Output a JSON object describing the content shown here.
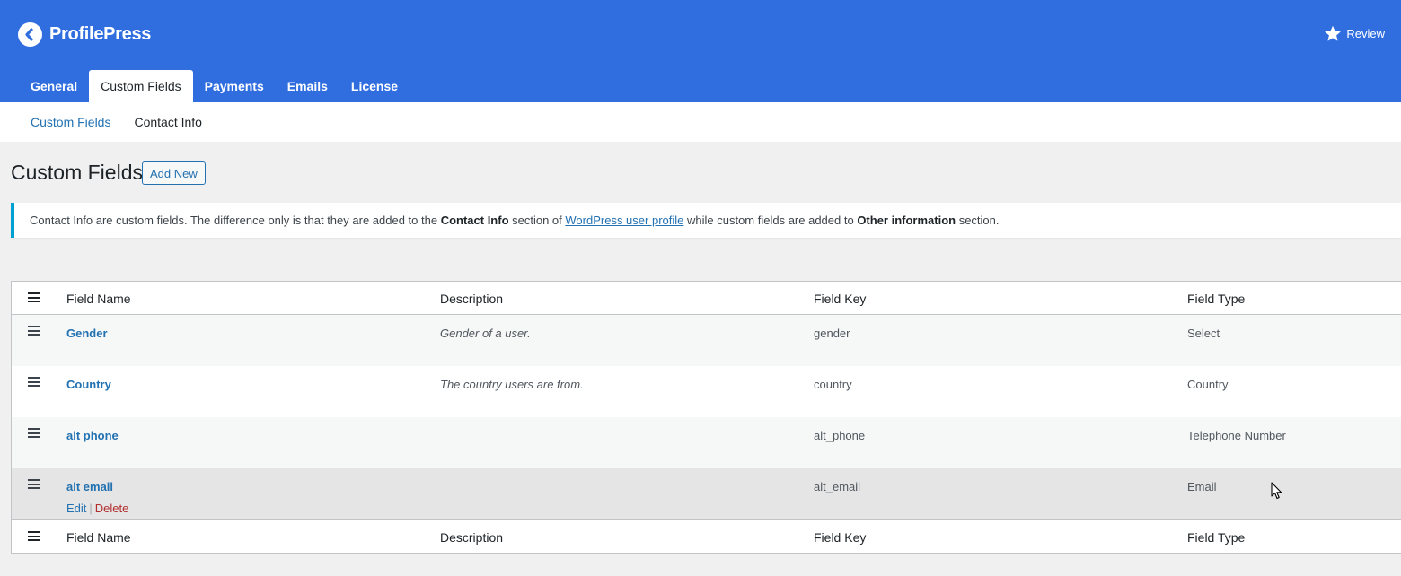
{
  "brand": {
    "name_bold": "Profile",
    "name_rest": "Press"
  },
  "header": {
    "review_label": "Review"
  },
  "tabs": [
    {
      "label": "General"
    },
    {
      "label": "Custom Fields"
    },
    {
      "label": "Payments"
    },
    {
      "label": "Emails"
    },
    {
      "label": "License"
    }
  ],
  "subtabs": [
    {
      "label": "Custom Fields"
    },
    {
      "label": "Contact Info"
    }
  ],
  "page": {
    "title": "Custom Fields",
    "add_new_label": "Add New"
  },
  "notice": {
    "part1": "Contact Info are custom fields. The difference only is that they are added to the ",
    "bold1": "Contact Info",
    "part2": " section of ",
    "link": "WordPress user profile",
    "part3": " while custom fields are added to ",
    "bold2": "Other information",
    "part4": " section."
  },
  "table": {
    "columns": {
      "name": "Field Name",
      "description": "Description",
      "key": "Field Key",
      "type": "Field Type"
    },
    "rows": [
      {
        "name": "Gender",
        "description": "Gender of a user.",
        "key": "gender",
        "type": "Select"
      },
      {
        "name": "Country",
        "description": "The country users are from.",
        "key": "country",
        "type": "Country"
      },
      {
        "name": "alt phone",
        "description": "",
        "key": "alt_phone",
        "type": "Telephone Number"
      },
      {
        "name": "alt email",
        "description": "",
        "key": "alt_email",
        "type": "Email"
      }
    ],
    "row_actions": {
      "edit": "Edit",
      "separator": "|",
      "delete": "Delete"
    }
  },
  "colors": {
    "header_bg": "#306ee0",
    "link": "#2271b1",
    "delete": "#b32d2e",
    "notice_border": "#00a0d2"
  }
}
